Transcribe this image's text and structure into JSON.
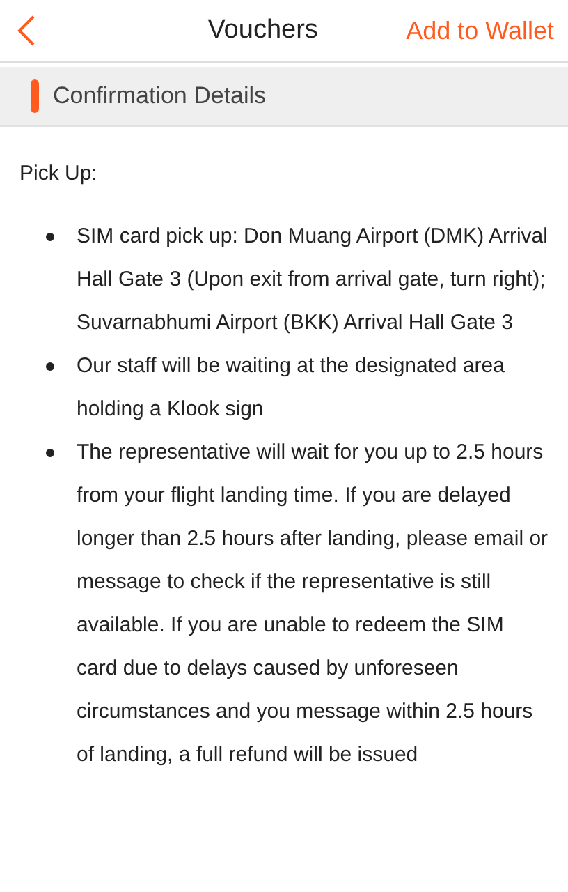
{
  "header": {
    "title": "Vouchers",
    "action": "Add to Wallet"
  },
  "section": {
    "title": "Confirmation Details"
  },
  "pickup": {
    "heading": "Pick Up:",
    "items": [
      "SIM card pick up: Don Muang Airport (DMK) Arrival Hall Gate 3 (Upon exit from arrival gate, turn right); Suvarnabhumi Airport (BKK) Arrival Hall Gate 3",
      "Our staff will be waiting at the designated area holding a Klook sign",
      "The representative will wait for you up to 2.5 hours from your flight landing time. If you are delayed longer than 2.5 hours after landing, please email or message to check if the representative is still available. If you are unable to redeem the SIM card due to delays caused by unforeseen circumstances and you message within 2.5 hours of landing, a full refund will be issued"
    ]
  }
}
